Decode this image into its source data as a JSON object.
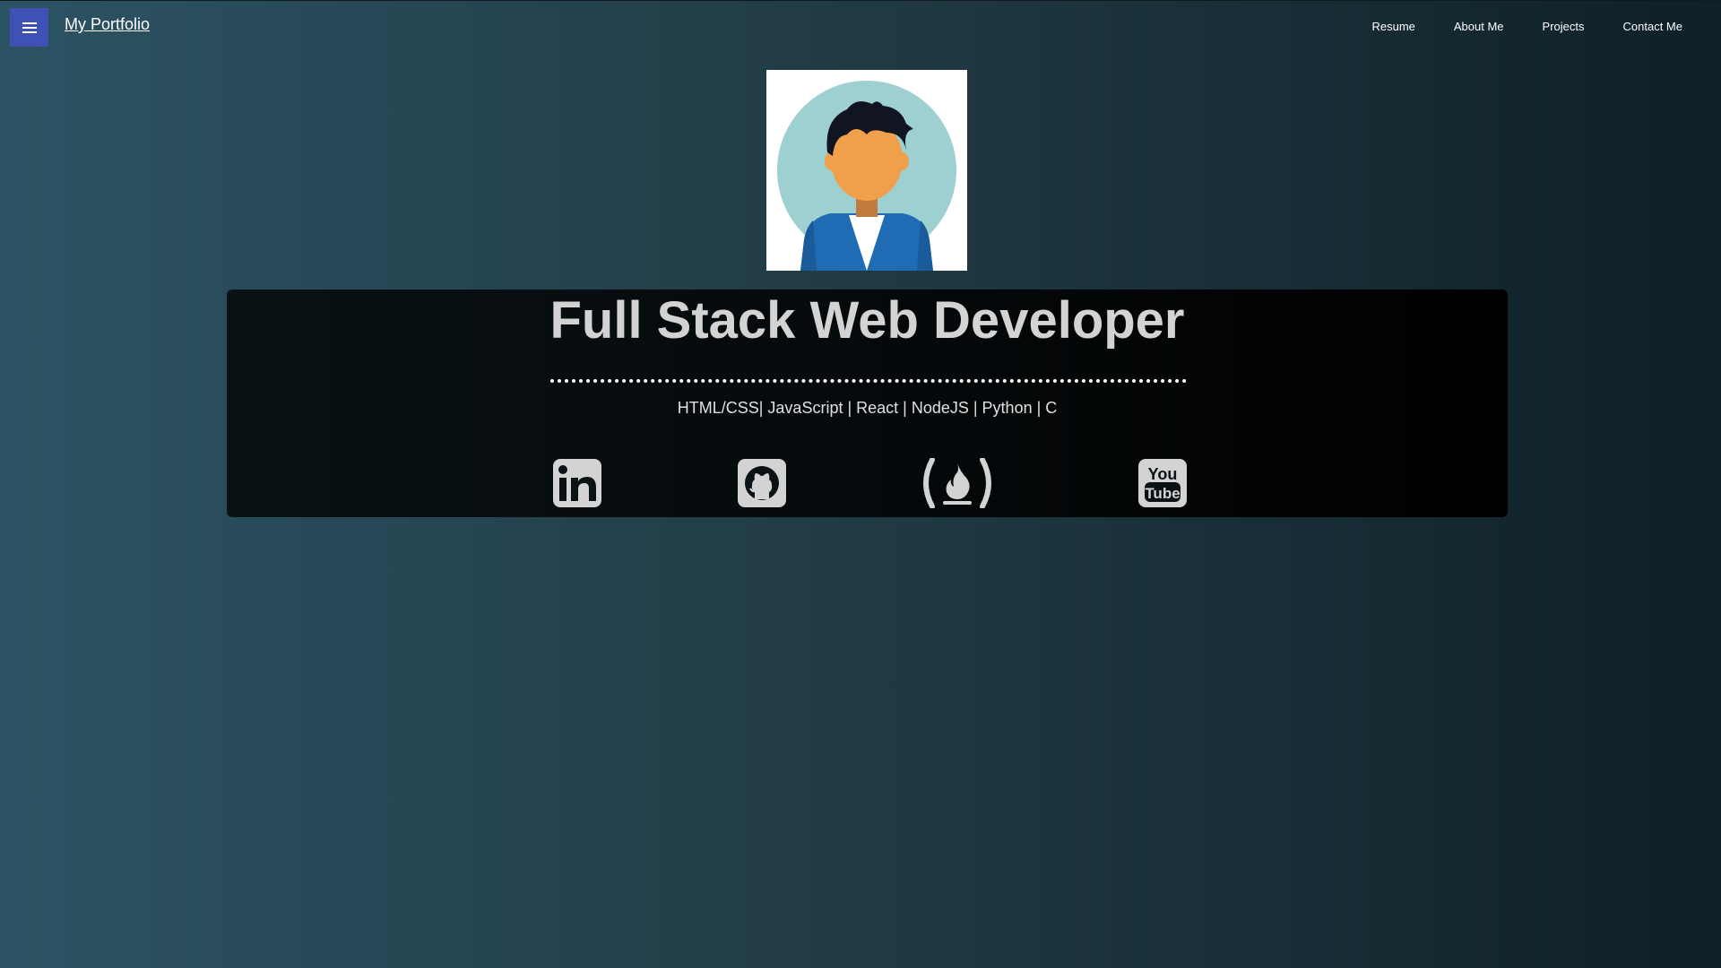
{
  "header": {
    "menu_icon": "hamburger-menu-icon",
    "brand": "My Portfolio",
    "nav": [
      {
        "label": "Resume"
      },
      {
        "label": "About Me"
      },
      {
        "label": "Projects"
      },
      {
        "label": "Contact Me"
      }
    ]
  },
  "hero": {
    "title": "Full Stack Web Developer",
    "skills": "HTML/CSS| JavaScript | React | NodeJS | Python | C",
    "social": [
      {
        "icon": "linkedin-icon"
      },
      {
        "icon": "github-icon"
      },
      {
        "icon": "freecodecamp-icon"
      },
      {
        "icon": "youtube-icon"
      }
    ]
  },
  "colors": {
    "menu_button": "#3f51b5",
    "avatar_bg_circle": "#9ed0d2",
    "title_text": "#d3d3d3"
  }
}
